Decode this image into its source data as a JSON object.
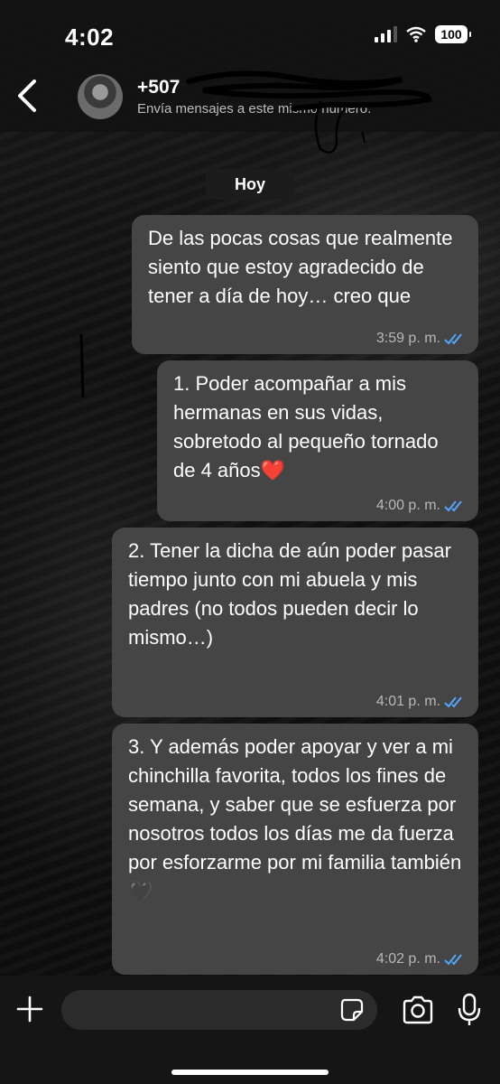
{
  "status_bar": {
    "time": "4:02",
    "battery": "100"
  },
  "contact": {
    "name": "+507",
    "subtitle": "Envía mensajes a este mismo número."
  },
  "date_separator": "Hoy",
  "messages": [
    {
      "text": "De las pocas cosas que realmente siento que estoy agradecido de tener a día de hoy… creo que",
      "time": "3:59 p. m."
    },
    {
      "text": "1. Poder acompañar a mis hermanas en sus vidas, sobretodo al pequeño tornado de 4 años❤️",
      "time": "4:00 p. m."
    },
    {
      "text": "2. Tener la dicha de aún poder pasar tiempo junto con mi abuela y mis padres (no todos pueden decir lo mismo…)",
      "time": "4:01 p. m."
    },
    {
      "text": "3. Y además poder apoyar y ver a mi chinchilla favorita, todos los fines de semana, y saber que se esfuerza por nosotros todos los días me da fuerza por esforzarme por mi familia también 🖤",
      "time": "4:02 p. m."
    }
  ],
  "colors": {
    "bubble": "#454545",
    "read_ticks": "#53a6fd",
    "background": "#0b0b0b"
  },
  "icons": [
    "back-chevron-icon",
    "avatar",
    "signal-icon",
    "wifi-icon",
    "battery-icon",
    "plus-icon",
    "sticker-icon",
    "camera-icon",
    "microphone-icon"
  ]
}
